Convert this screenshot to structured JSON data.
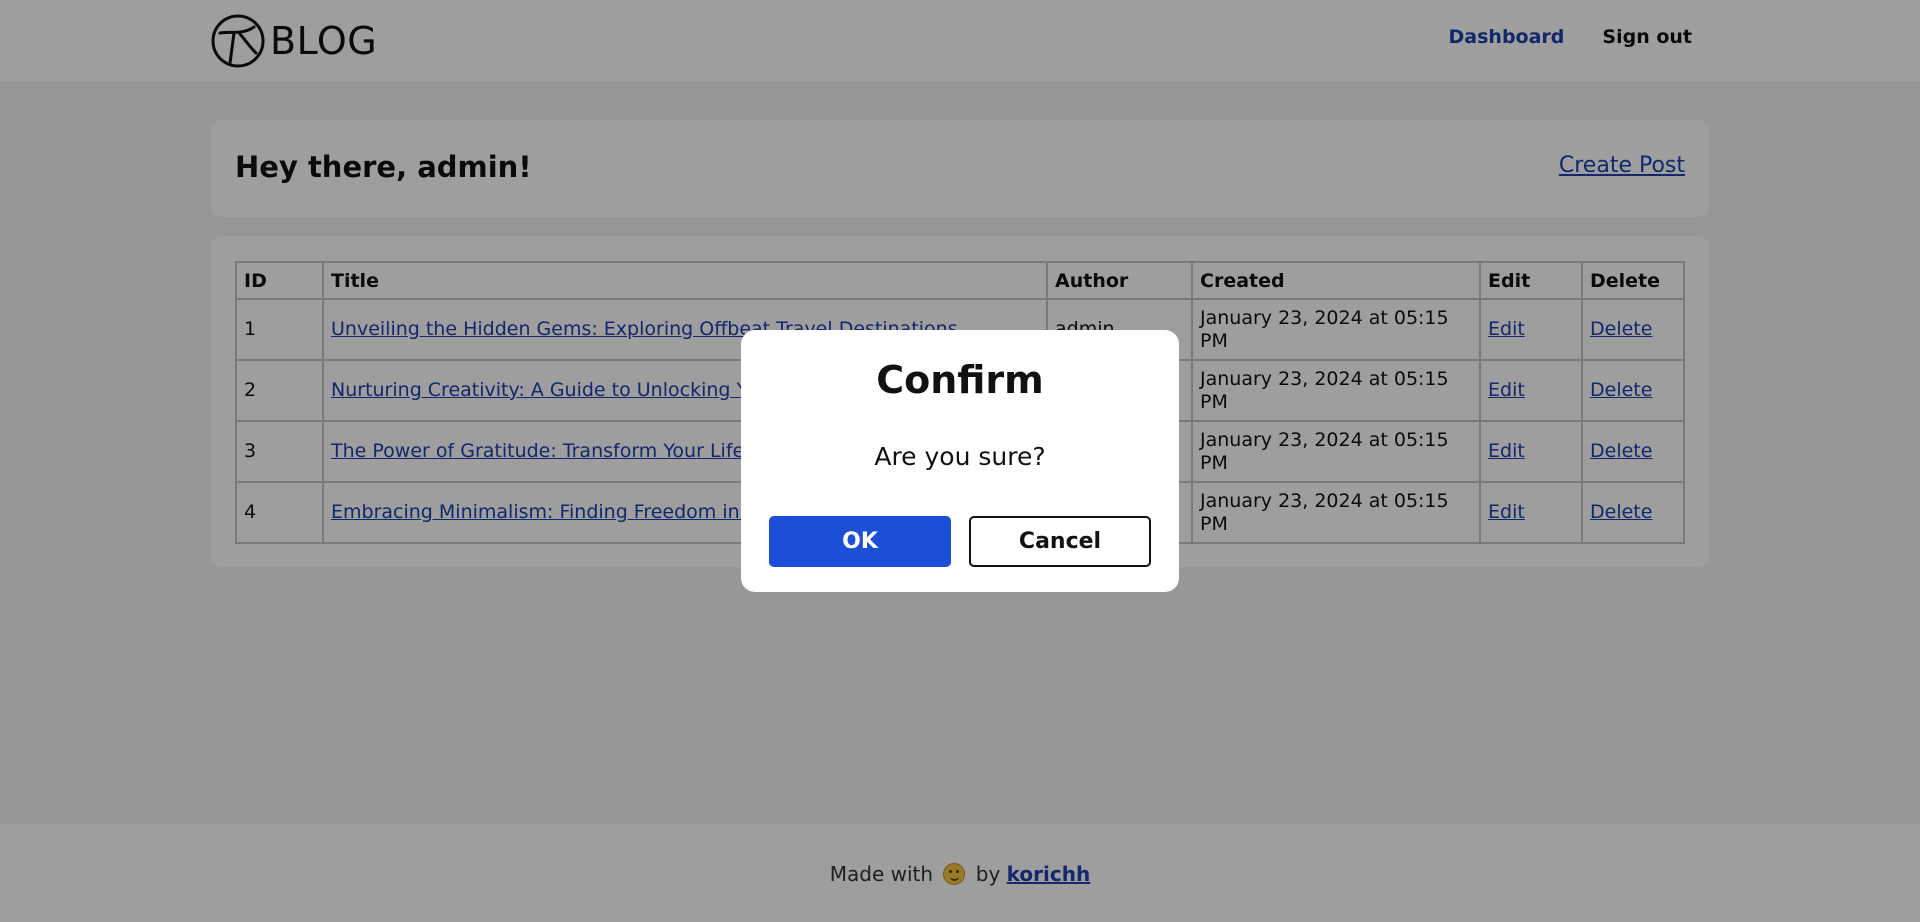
{
  "header": {
    "logo_text": "BLOG",
    "logo_icon": "plane-circle-icon",
    "nav": {
      "dashboard": "Dashboard",
      "sign_out": "Sign out"
    }
  },
  "greeting_card": {
    "greeting": "Hey there, admin!",
    "create_post": "Create Post"
  },
  "posts_table": {
    "headers": {
      "id": "ID",
      "title": "Title",
      "author": "Author",
      "created": "Created",
      "edit": "Edit",
      "delete": "Delete"
    },
    "rows": [
      {
        "id": "1",
        "title": "Unveiling the Hidden Gems: Exploring Offbeat Travel Destinations",
        "author": "admin",
        "created": "January 23, 2024 at 05:15 PM",
        "edit": "Edit",
        "delete": "Delete"
      },
      {
        "id": "2",
        "title": "Nurturing Creativity: A Guide to Unlocking Yo",
        "author": "",
        "created": "January 23, 2024 at 05:15 PM",
        "edit": "Edit",
        "delete": "Delete"
      },
      {
        "id": "3",
        "title": "The Power of Gratitude: Transform Your Life w",
        "author": "",
        "created": "January 23, 2024 at 05:15 PM",
        "edit": "Edit",
        "delete": "Delete"
      },
      {
        "id": "4",
        "title": "Embracing Minimalism: Finding Freedom in S",
        "author": "",
        "created": "January 23, 2024 at 05:15 PM",
        "edit": "Edit",
        "delete": "Delete"
      }
    ]
  },
  "footer": {
    "made_with": "Made with",
    "emoji_icon": "hugging-face-emoji-icon",
    "by": "by",
    "author_link": "korichh"
  },
  "modal": {
    "title": "Confirm",
    "message": "Are you sure?",
    "ok_label": "OK",
    "cancel_label": "Cancel"
  },
  "colors": {
    "link_blue": "#1e40af",
    "primary_button": "#1d4ed8",
    "page_background": "#f3f4f6",
    "overlay": "rgba(0,0,0,0.38)"
  }
}
